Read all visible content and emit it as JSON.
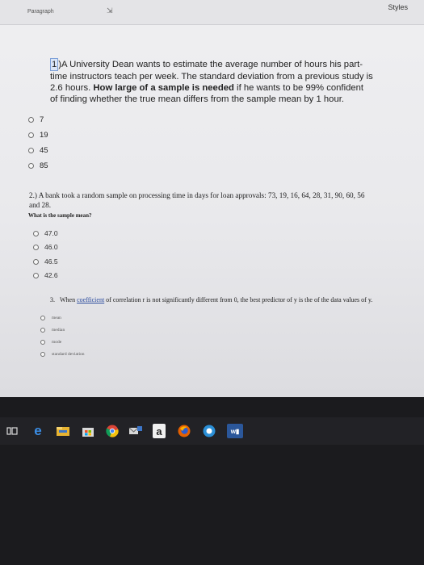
{
  "ribbon": {
    "paragraph_label": "Paragraph",
    "styles_label": "Styles"
  },
  "question1": {
    "number": "1",
    "text": ")A University Dean wants to estimate the average number of hours his part-time instructors teach per week. The standard deviation from a previous study is 2.6 hours. ",
    "bold": "How large of a sample is needed",
    "text_after": " if he wants to be 99% confident of finding whether the true mean differs from the sample mean by 1 hour.",
    "options": [
      "7",
      "19",
      "45",
      "85"
    ]
  },
  "question2": {
    "text": "2.) A bank took a random sample on processing time in days for loan approvals: 73, 19, 16, 64, 28, 31, 90, 60, 56 and 28.",
    "sub": "What is the sample mean?",
    "options": [
      "47.0",
      "46.0",
      "46.5",
      "42.6"
    ]
  },
  "question3": {
    "number": "3.",
    "text_before": "When ",
    "link": "coefficient",
    "text_after": " of correlation r is not significantly different from 0, the best predictor of y is the  of the data values of y.",
    "options": [
      "mean",
      "median",
      "mode",
      "standard deviation"
    ]
  },
  "taskbar": {
    "accent": "#1f6fd1",
    "icons": [
      "task-view-icon",
      "edge-icon",
      "file-explorer-icon",
      "store-icon",
      "chrome-icon",
      "email-icon",
      "amazon-icon",
      "firefox-icon",
      "app-icon",
      "word-icon"
    ],
    "amazon_letter": "a"
  }
}
